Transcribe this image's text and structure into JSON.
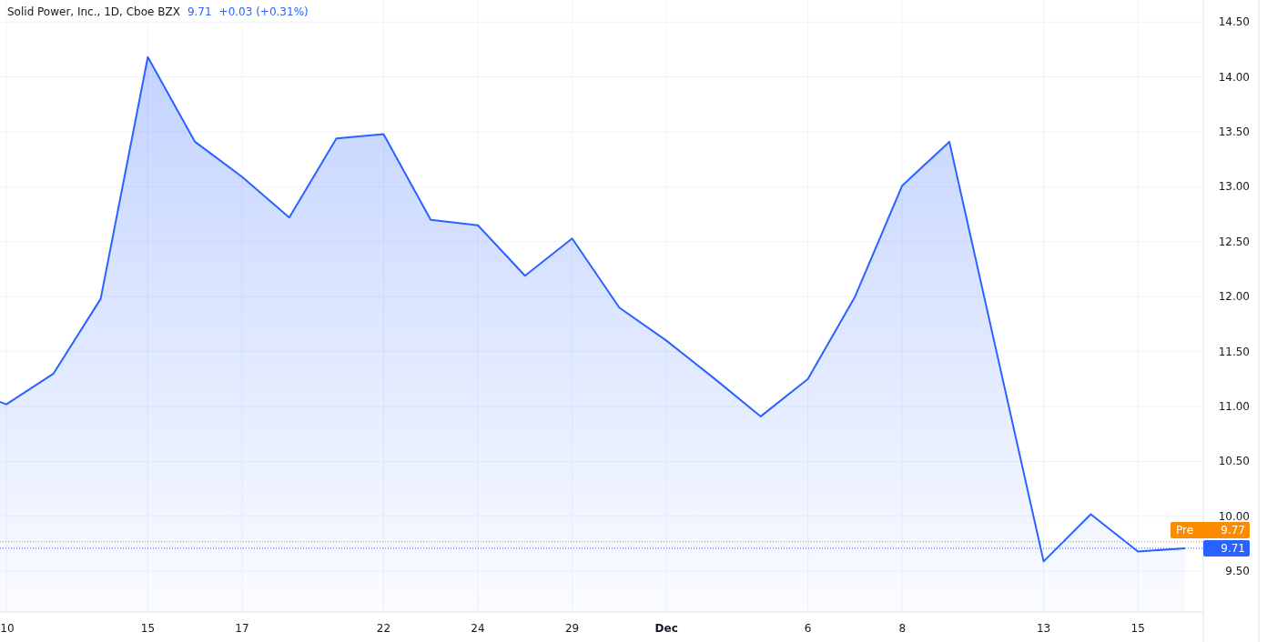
{
  "header": {
    "title": "Solid Power, Inc., 1D, Cboe BZX",
    "price": "9.71",
    "change": "+0.03 (+0.31%)"
  },
  "chart_data": {
    "type": "area",
    "categories": [
      null,
      "10",
      null,
      null,
      "15",
      null,
      "17",
      null,
      null,
      "22",
      null,
      "24",
      null,
      "29",
      null,
      "Dec",
      null,
      null,
      "6",
      null,
      "8",
      null,
      null,
      "13",
      null,
      "15",
      null
    ],
    "series": [
      {
        "color": "#2962ff",
        "values": [
          11.18,
          11.02,
          11.3,
          11.98,
          14.18,
          13.41,
          13.09,
          12.72,
          13.44,
          13.48,
          12.7,
          12.65,
          12.19,
          12.53,
          11.9,
          11.6,
          11.26,
          10.91,
          11.25,
          12.0,
          13.01,
          13.41,
          11.5,
          9.59,
          10.02,
          9.68,
          9.71
        ]
      }
    ],
    "ylim": [
      9.13,
      14.7
    ],
    "grid": true,
    "ref_lines": [
      {
        "axis": "y",
        "value": 9.77,
        "color": "#fb8c00"
      },
      {
        "axis": "y",
        "value": 9.71,
        "color": "#2962ff"
      }
    ],
    "yticks": [
      {
        "value": 9.5,
        "label": "9.50"
      },
      {
        "value": 10,
        "label": "10.00"
      },
      {
        "value": 10.5,
        "label": "10.50"
      },
      {
        "value": 11,
        "label": "11.00"
      },
      {
        "value": 11.5,
        "label": "11.50"
      },
      {
        "value": 12,
        "label": "12.00"
      },
      {
        "value": 12.5,
        "label": "12.50"
      },
      {
        "value": 13,
        "label": "13.00"
      },
      {
        "value": 13.5,
        "label": "13.50"
      },
      {
        "value": 14,
        "label": "14.00"
      },
      {
        "value": 14.5,
        "label": "14.50"
      }
    ]
  },
  "price_labels": [
    {
      "kind": "premarket",
      "label": "Pre",
      "value": "9.77",
      "color": "#fb8c00"
    },
    {
      "kind": "last",
      "value": "9.71",
      "color": "#2962ff"
    }
  ]
}
